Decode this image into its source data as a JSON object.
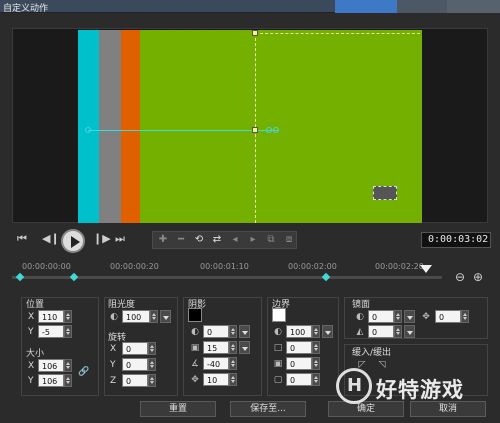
{
  "window": {
    "title": "自定义动作"
  },
  "playback": {
    "timecode": "0:00:03:02"
  },
  "timeline": {
    "labels": [
      "00:00:00:00",
      "00:00:00:20",
      "00:00:01:10",
      "00:00:02:00",
      "00:00:02:20"
    ]
  },
  "position": {
    "label": "位置",
    "x_label": "X",
    "x": "110",
    "y_label": "Y",
    "y": "-5"
  },
  "size": {
    "label": "大小",
    "x_label": "X",
    "x": "106",
    "y_label": "Y",
    "y": "106"
  },
  "opacity": {
    "label": "阻光度",
    "value": "100"
  },
  "rotation": {
    "label": "旋转",
    "x_label": "X",
    "x": "0",
    "y_label": "Y",
    "y": "0",
    "z_label": "Z",
    "z": "0"
  },
  "shadow": {
    "label": "阴影",
    "color": "#000000",
    "v1": "0",
    "v2": "15",
    "v3": "-40",
    "v4": "10"
  },
  "border": {
    "label": "边界",
    "color": "#ffffff",
    "v1": "100",
    "v2": "0",
    "v3": "0",
    "v4": "0"
  },
  "mirror": {
    "label": "镜面",
    "v1": "0",
    "v2": "0",
    "v3": "0"
  },
  "fade": {
    "label": "缓入/缓出"
  },
  "buttons": {
    "reset": "重置",
    "save": "保存至...",
    "ok": "确定",
    "cancel": "取消"
  },
  "watermark": {
    "logo": "H",
    "text": "好特游戏"
  },
  "colors": {
    "canvas": "#74b000",
    "cyan": "#00c0cc",
    "gray": "#808080",
    "orange": "#e06000",
    "path": "#3fd9d9"
  }
}
